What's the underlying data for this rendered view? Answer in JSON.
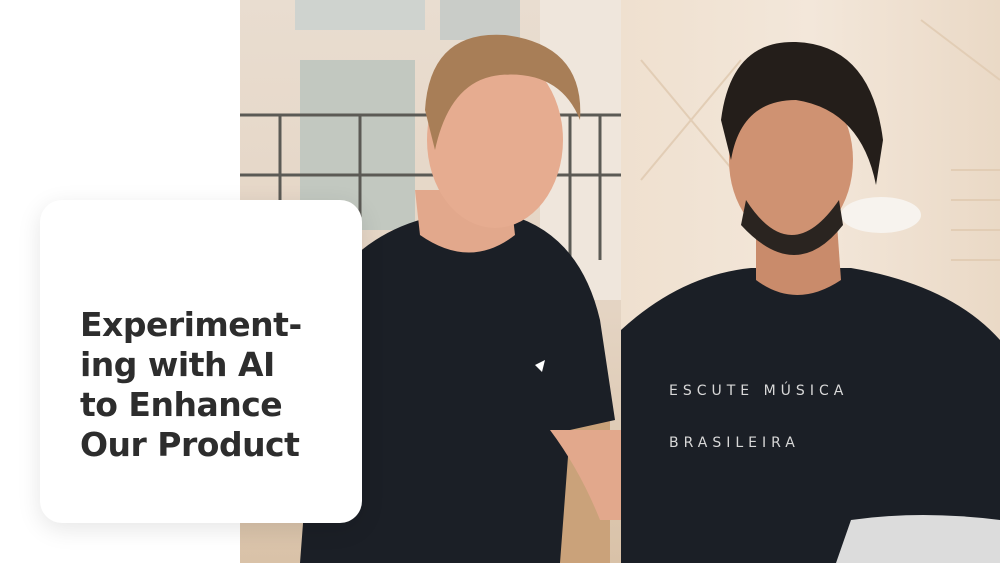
{
  "card": {
    "title_lines": [
      "Experiment-",
      "ing with AI",
      "to Enhance",
      "Our Product"
    ]
  },
  "shirt_print": {
    "line1": "ESCUTE MÚSICA",
    "line2": "BRASILEIRA"
  },
  "colors": {
    "title_text": "#2d2d2d",
    "card_bg": "#ffffff",
    "shirt": "#1b1f26"
  }
}
